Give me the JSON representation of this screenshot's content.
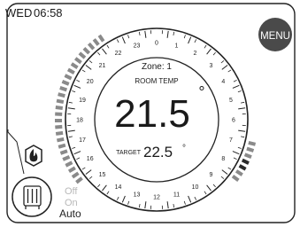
{
  "header": {
    "day": "WED",
    "time": "06:58"
  },
  "menu_label": "MENU",
  "dial": {
    "hours": [
      "0",
      "1",
      "2",
      "3",
      "4",
      "5",
      "6",
      "7",
      "8",
      "9",
      "10",
      "11",
      "12",
      "13",
      "14",
      "15",
      "16",
      "17",
      "18",
      "19",
      "20",
      "21",
      "22",
      "23"
    ],
    "zone_label": "Zone: 1",
    "room_label": "ROOM TEMP",
    "current_temp": "21.5",
    "degree_symbol": "°",
    "target_label": "TARGET",
    "target_temp": "22.5"
  },
  "mode": {
    "off": "Off",
    "on": "On",
    "auto": "Auto"
  },
  "icons": {
    "flame": "flame-icon",
    "radiator": "radiator-icon",
    "menu": "menu-icon"
  },
  "colors": {
    "accent": "#4a4a4a",
    "schedule": "#8a8a8a",
    "active": "#2a2a2a",
    "text": "#1a1a1a"
  }
}
